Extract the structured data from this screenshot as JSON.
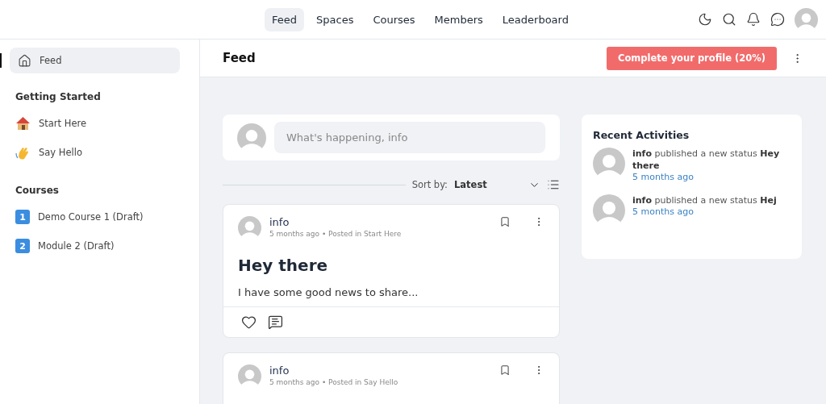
{
  "top_nav": {
    "tabs": [
      {
        "label": "Feed",
        "selected": true
      },
      {
        "label": "Spaces",
        "selected": false
      },
      {
        "label": "Courses",
        "selected": false
      },
      {
        "label": "Members",
        "selected": false
      },
      {
        "label": "Leaderboard",
        "selected": false
      }
    ]
  },
  "sidebar": {
    "feed_item": {
      "label": "Feed",
      "selected": true
    },
    "groups": [
      {
        "title": "Getting Started",
        "items": [
          {
            "kind": "house",
            "label": "Start Here"
          },
          {
            "kind": "wave",
            "label": "Say Hello"
          }
        ]
      },
      {
        "title": "Courses",
        "items": [
          {
            "kind": "number",
            "badge": "1",
            "label": "Demo Course 1 (Draft)"
          },
          {
            "kind": "number",
            "badge": "2",
            "label": "Module 2 (Draft)"
          }
        ]
      }
    ]
  },
  "header": {
    "title": "Feed",
    "profile_button": "Complete your profile (20%)"
  },
  "composer": {
    "placeholder": "What's happening, info"
  },
  "sort": {
    "label": "Sort by:",
    "value": "Latest"
  },
  "posts": [
    {
      "author": "info",
      "meta": "5 months ago • Posted in Start Here",
      "title": "Hey there",
      "body": "I have some good news to share..."
    },
    {
      "author": "info",
      "meta": "5 months ago • Posted in Say Hello"
    }
  ],
  "recent_activities": {
    "title": "Recent Activities",
    "items": [
      {
        "text": "**info** published a new status **Hey there**",
        "time": "5 months ago"
      },
      {
        "text": "**info** published a new status **Hej**",
        "time": "5 months ago"
      }
    ]
  }
}
